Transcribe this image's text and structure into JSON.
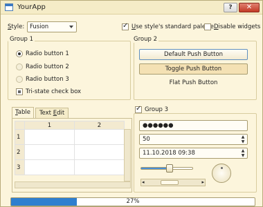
{
  "window": {
    "title": "YourApp",
    "help_label": "?",
    "close_label": "✕"
  },
  "style_row": {
    "style_label_u": "S",
    "style_label_rest": "tyle:",
    "style_value": "Fusion",
    "palette_label_u": "U",
    "palette_label_rest": "se style's standard palette",
    "palette_checked": true,
    "disable_label_u": "D",
    "disable_label_rest": "isable widgets",
    "disable_checked": false
  },
  "group1": {
    "title": "Group 1",
    "radio1": "Radio button 1",
    "radio2": "Radio button 2",
    "radio3": "Radio button 3",
    "tristate": "Tri-state check box"
  },
  "group2": {
    "title": "Group 2",
    "default_btn": "Default Push Button",
    "toggle_btn": "Toggle Push Button",
    "flat_btn": "Flat Push Button"
  },
  "tabs": {
    "tab1_u": "T",
    "tab1_rest": "able",
    "tab2_pre": "Text ",
    "tab2_u": "E",
    "tab2_rest": "dit",
    "columns": [
      "1",
      "2"
    ],
    "rows": [
      "1",
      "2",
      "3"
    ]
  },
  "group3": {
    "title": "Group 3",
    "checked": true,
    "password": "●●●●●●",
    "spin_value": "50",
    "datetime": "11.10.2018 09:38",
    "slider_fraction": 0.55,
    "scroll_fraction": 0.35
  },
  "progress": {
    "value": 0.27,
    "label": "27%"
  },
  "colors": {
    "progress": "#2f7fcf",
    "accent": "#4a90d9",
    "close": "#c23a25"
  }
}
